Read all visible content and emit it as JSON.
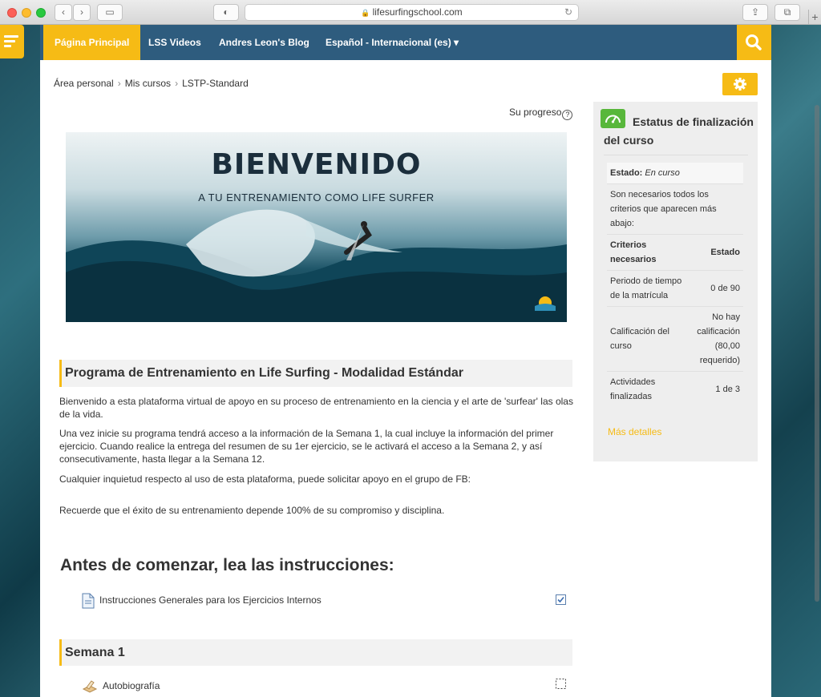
{
  "browser": {
    "url": "lifesurfingschool.com"
  },
  "nav": {
    "items": [
      "Página Principal",
      "LSS Videos",
      "Andres Leon's Blog",
      "Español - Internacional (es)"
    ],
    "dropdown_caret": "▾"
  },
  "breadcrumb": [
    "Área personal",
    "Mis cursos",
    "LSTP-Standard"
  ],
  "progress": {
    "label": "Su progreso",
    "help": "?"
  },
  "banner": {
    "title": "BIENVENIDO",
    "subtitle": "A TU ENTRENAMIENTO COMO LIFE SURFER"
  },
  "course": {
    "program_title": "Programa de Entrenamiento en Life Surfing - Modalidad Estándar",
    "paragraphs": [
      "Bienvenido a esta plataforma virtual de apoyo en su proceso de entrenamiento en la ciencia y el arte de 'surfear' las olas de la vida.",
      "Una vez inicie su programa tendrá acceso a la información de la Semana 1, la cual incluye la información del primer ejercicio.  Cuando realice la entrega del resumen de su 1er ejercicio, se le activará el acceso a la Semana 2, y así consecutivamente, hasta llegar a la Semana 12.",
      "Cualquier inquietud respecto al uso de esta plataforma, puede solicitar apoyo en el grupo de FB:",
      "Recuerde que el éxito de su entrenamiento depende 100% de su compromiso y disciplina."
    ],
    "instructions_heading": "Antes de comenzar, lea las instrucciones:",
    "instructions_activity": "Instrucciones Generales para los Ejercicios Internos",
    "week1_title": "Semana 1",
    "week1_activity": "Autobiografía"
  },
  "completion_block": {
    "title": "Estatus de finalización del curso",
    "status_label": "Estado:",
    "status_value": "En curso",
    "requirement_note": "Son necesarios todos los criterios que aparecen más abajo:",
    "col_criteria": "Criterios necesarios",
    "col_status": "Estado",
    "rows": [
      {
        "criterion": "Periodo de tiempo de la matrícula",
        "status": "0 de 90"
      },
      {
        "criterion": "Calificación del curso",
        "status": "No hay calificación (80,00 requerido)"
      },
      {
        "criterion": "Actividades finalizadas",
        "status": "1 de 3"
      }
    ],
    "more_link": "Más detalles"
  },
  "colors": {
    "accent": "#f6bb15",
    "navbar": "#2e5c7e",
    "completion_green": "#58b73b"
  }
}
